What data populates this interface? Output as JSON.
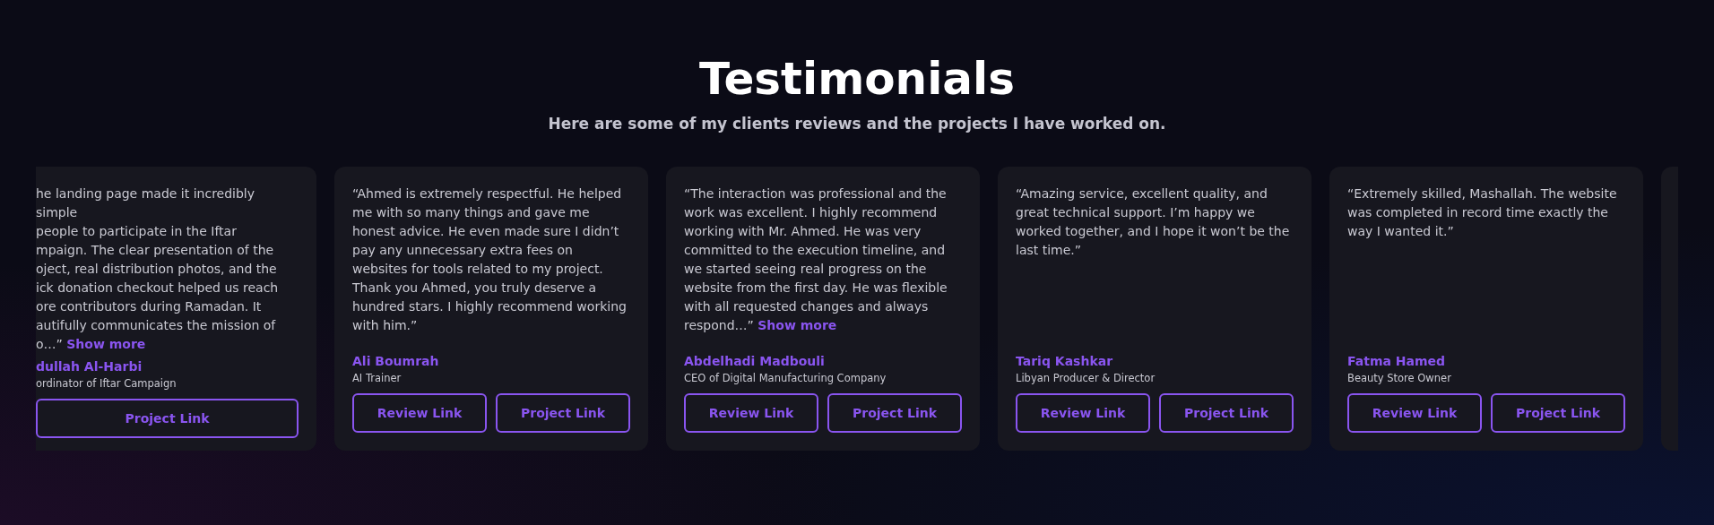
{
  "title": "Testimonials",
  "subtitle": "Here are some of my clients reviews and the projects I have worked on.",
  "cards": [
    {
      "kind": "clipped",
      "lines": [
        "he landing page made it incredibly simple",
        "people to participate in the Iftar",
        "mpaign. The clear presentation of the",
        "oject, real distribution photos, and the",
        "ick donation checkout helped us reach",
        "ore contributors during Ramadan. It",
        "autifully communicates the mission of",
        "o…”"
      ],
      "show_more": "Show more",
      "name": "dullah Al-Harbi",
      "role": "ordinator of Iftar Campaign",
      "links": [
        "Project Link"
      ]
    },
    {
      "kind": "full",
      "quote": "“Ahmed is extremely respectful. He helped me with so many things and gave me honest advice. He even made sure I didn’t pay any unnecessary extra fees on websites for tools related to my project. Thank you Ahmed, you truly deserve a hundred stars. I highly recommend working with him.”",
      "name": "Ali Boumrah",
      "role": "AI Trainer",
      "links": [
        "Review Link",
        "Project Link"
      ]
    },
    {
      "kind": "full",
      "quote": "“The interaction was professional and the work was excellent. I highly recommend working with Mr. Ahmed. He was very committed to the execution timeline, and we started seeing real progress on the website from the first day. He was flexible with all requested changes and always respond…”",
      "show_more": "Show more",
      "name": "Abdelhadi Madbouli",
      "role": "CEO of Digital Manufacturing Company",
      "links": [
        "Review Link",
        "Project Link"
      ]
    },
    {
      "kind": "full",
      "quote": "“Amazing service, excellent quality, and great technical support. I’m happy we worked together, and I hope it won’t be the last time.”",
      "name": "Tariq Kashkar",
      "role": "Libyan Producer & Director",
      "links": [
        "Review Link",
        "Project Link"
      ]
    },
    {
      "kind": "full",
      "quote": "“Extremely skilled, Mashallah. The website was completed in record time exactly the way I wanted it.”",
      "name": "Fatma Hamed",
      "role": "Beauty Store Owner",
      "links": [
        "Review Link",
        "Project Link"
      ]
    },
    {
      "kind": "edge"
    }
  ]
}
